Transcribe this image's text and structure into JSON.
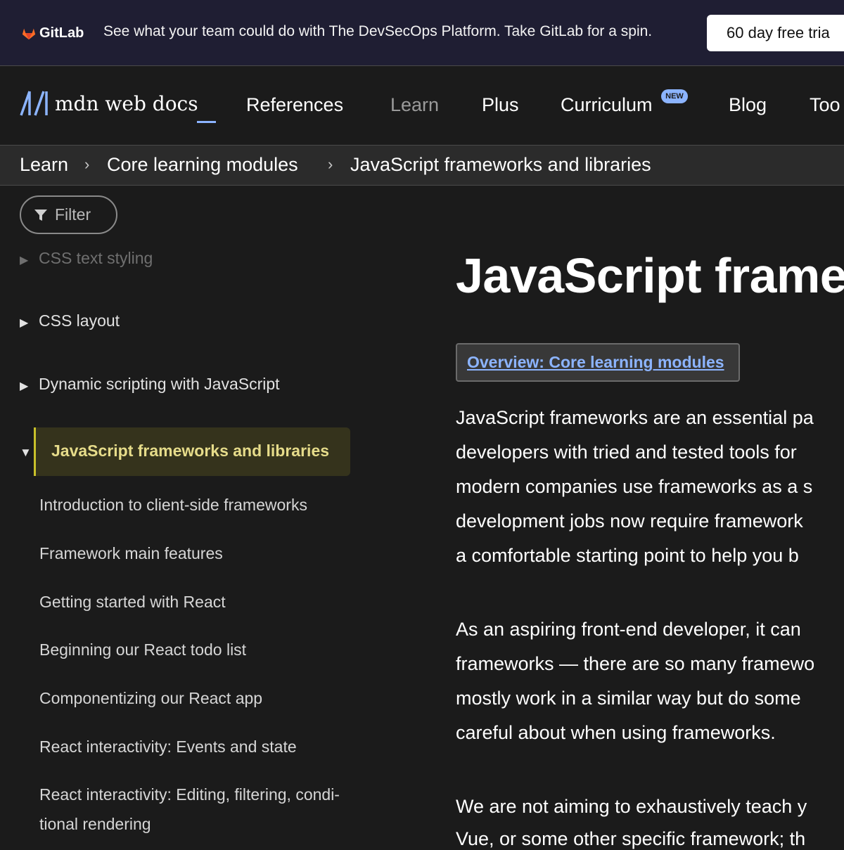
{
  "banner": {
    "logo_text": "GitLab",
    "text": "See what your team could do with The DevSecOps Platform. Take GitLab for a spin.",
    "cta": "60 day free tria"
  },
  "nav": {
    "logo_text": "mdn web docs",
    "items": [
      {
        "label": "References"
      },
      {
        "label": "Learn"
      },
      {
        "label": "Plus"
      },
      {
        "label": "Curriculum",
        "badge": "NEW"
      },
      {
        "label": "Blog"
      },
      {
        "label": "Too"
      }
    ]
  },
  "breadcrumb": [
    "Learn",
    "Core learning modules",
    "JavaScript frameworks and libraries"
  ],
  "sidebar": {
    "filter_label": "Filter",
    "items": [
      {
        "label": "CSS text styling"
      },
      {
        "label": "CSS layout"
      },
      {
        "label": "Dynamic scripting with JavaScript"
      }
    ],
    "active": "JavaScript frameworks and libraries",
    "sub_items": [
      "Introduction to client-side frameworks",
      "Framework main features",
      "Getting started with React",
      "Beginning our React todo list",
      "Componentizing our React app",
      "React interactivity: Events and state",
      "React interactivity: Editing, filtering, condi-",
      "tional rendering"
    ]
  },
  "main": {
    "title": "JavaScript frame",
    "overview_link": "Overview: Core learning modules",
    "paragraph_lines": [
      "JavaScript frameworks are an essential pa",
      "developers with tried and tested tools for",
      "modern companies use frameworks as a s",
      "development jobs now require framework",
      "a comfortable starting point to help you b",
      "As an aspiring front-end developer, it can",
      "frameworks — there are so many framewo",
      "mostly work in a similar way but do some",
      "careful about when using frameworks.",
      "We are not aiming to exhaustively teach y",
      "Vue, or some other specific framework; th"
    ]
  },
  "colors": {
    "accent": "#8cb4ff",
    "active_highlight": "#c9c12a",
    "gitlab_orange": "#fc6d26"
  }
}
